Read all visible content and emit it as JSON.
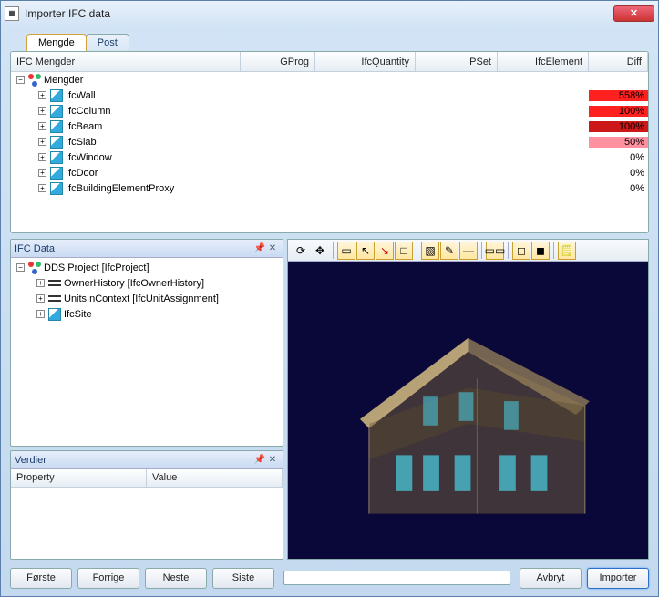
{
  "window": {
    "title": "Importer IFC data"
  },
  "tabs": [
    {
      "label": "Mengde",
      "active": true
    },
    {
      "label": "Post",
      "active": false
    }
  ],
  "grid": {
    "headers": {
      "col0": "IFC Mengder",
      "col1": "GProg",
      "col2": "IfcQuantity",
      "col3": "PSet",
      "col4": "IfcElement",
      "col5": "Diff"
    },
    "root": {
      "label": "Mengder"
    },
    "rows": [
      {
        "label": "IfcWall",
        "diff": "558%",
        "bg": "#ff2020"
      },
      {
        "label": "IfcColumn",
        "diff": "100%",
        "bg": "#ff2020"
      },
      {
        "label": "IfcBeam",
        "diff": "100%",
        "bg": "#cc1818"
      },
      {
        "label": "IfcSlab",
        "diff": "50%",
        "bg": "#ff90a0"
      },
      {
        "label": "IfcWindow",
        "diff": "0%",
        "bg": ""
      },
      {
        "label": "IfcDoor",
        "diff": "0%",
        "bg": ""
      },
      {
        "label": "IfcBuildingElementProxy",
        "diff": "0%",
        "bg": ""
      }
    ]
  },
  "ifc_data_panel": {
    "title": "IFC Data",
    "tree": {
      "root": "DDS Project [IfcProject]",
      "children": [
        "OwnerHistory [IfcOwnerHistory]",
        "UnitsInContext [IfcUnitAssignment]",
        "IfcSite"
      ]
    }
  },
  "verdier_panel": {
    "title": "Verdier",
    "columns": {
      "c0": "Property",
      "c1": "Value"
    }
  },
  "viewer_toolbar_icons": [
    "orbit-icon",
    "pan-icon",
    "divider",
    "zoom-extents-icon",
    "select-arrow-icon",
    "select-red-icon",
    "rect-icon",
    "divider",
    "layer-icon",
    "annotate-icon",
    "minus-icon",
    "divider",
    "group-icon",
    "divider",
    "bbox-icon",
    "bbox-fill-icon",
    "divider",
    "note-icon"
  ],
  "buttons": {
    "first": "Første",
    "prev": "Forrige",
    "next": "Neste",
    "last": "Siste",
    "cancel": "Avbryt",
    "import": "Importer"
  }
}
